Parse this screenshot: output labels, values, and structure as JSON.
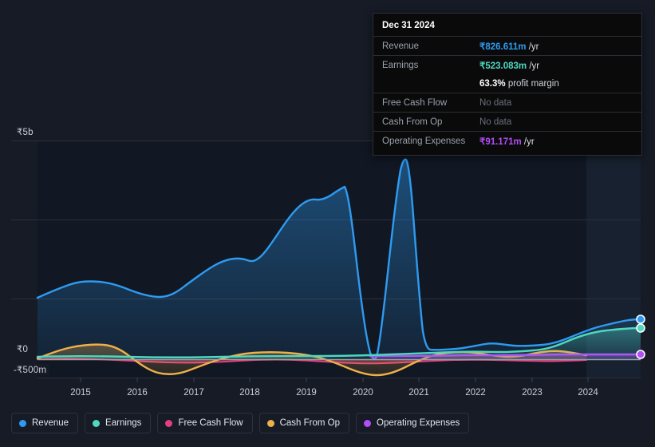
{
  "tooltip": {
    "title": "Dec 31 2024",
    "rows": [
      {
        "label": "Revenue",
        "amount": "₹826.611m",
        "unit": "/yr",
        "kind": "rev"
      },
      {
        "label": "Earnings",
        "amount": "₹523.083m",
        "unit": "/yr",
        "kind": "earn"
      },
      {
        "label": "",
        "amount": "63.3%",
        "unit": "profit margin",
        "kind": "margin"
      },
      {
        "label": "Free Cash Flow",
        "amount": "No data",
        "unit": "",
        "kind": "nodata"
      },
      {
        "label": "Cash From Op",
        "amount": "No data",
        "unit": "",
        "kind": "nodata"
      },
      {
        "label": "Operating Expenses",
        "amount": "₹91.171m",
        "unit": "/yr",
        "kind": "opex"
      }
    ]
  },
  "axis": {
    "y_labels": [
      "₹5b",
      "₹0",
      "-₹500m"
    ],
    "y_top": "₹5b",
    "y_zero": "₹0",
    "y_bottom": "-₹500m",
    "x_labels": [
      "2015",
      "2016",
      "2017",
      "2018",
      "2019",
      "2020",
      "2021",
      "2022",
      "2023",
      "2024"
    ]
  },
  "legend": {
    "items": [
      {
        "label": "Revenue",
        "color": "#2e9bf0"
      },
      {
        "label": "Earnings",
        "color": "#4fd8c0"
      },
      {
        "label": "Free Cash Flow",
        "color": "#e0407f"
      },
      {
        "label": "Cash From Op",
        "color": "#eeb04a"
      },
      {
        "label": "Operating Expenses",
        "color": "#b14ef5"
      }
    ]
  },
  "colors": {
    "background": "#161b26",
    "plot_background": "#111723",
    "forecast_background": "#18212f",
    "gridline": "#2a303c",
    "zero_line": "#9aa0ac",
    "revenue": "#2e9bf0",
    "earnings": "#4fd8c0",
    "free_cash_flow": "#e0407f",
    "cash_from_op": "#eeb04a",
    "operating_expenses": "#b14ef5"
  },
  "chart_data": {
    "type": "area",
    "title": "",
    "xlabel": "",
    "ylabel": "",
    "ylim": [
      -500000000,
      5000000000
    ],
    "y_ticks": [
      5000000000,
      3333000000,
      1667000000,
      0,
      -500000000
    ],
    "y_tick_labels": [
      "₹5b",
      "",
      "",
      "₹0",
      "-₹500m"
    ],
    "x": [
      "2015",
      "2016",
      "2017",
      "2018",
      "2019",
      "2020",
      "2021",
      "2022",
      "2023",
      "2024"
    ],
    "grid": true,
    "legend_position": "bottom",
    "forecast_start": "2024.0",
    "currency": "INR",
    "series": [
      {
        "name": "Revenue",
        "color": "#2e9bf0",
        "points": [
          {
            "x": 2014.45,
            "y": 1360
          },
          {
            "x": 2015.0,
            "y": 1480
          },
          {
            "x": 2015.4,
            "y": 1560
          },
          {
            "x": 2015.85,
            "y": 1540
          },
          {
            "x": 2016.3,
            "y": 1420
          },
          {
            "x": 2016.75,
            "y": 1385
          },
          {
            "x": 2017.1,
            "y": 1490
          },
          {
            "x": 2017.6,
            "y": 1660
          },
          {
            "x": 2018.1,
            "y": 1790
          },
          {
            "x": 2018.6,
            "y": 1880
          },
          {
            "x": 2018.9,
            "y": 1930
          },
          {
            "x": 2019.2,
            "y": 2300
          },
          {
            "x": 2019.55,
            "y": 2950
          },
          {
            "x": 2019.85,
            "y": 3720
          },
          {
            "x": 2020.0,
            "y": 3100
          },
          {
            "x": 2020.15,
            "y": 1500
          },
          {
            "x": 2020.35,
            "y": 330
          },
          {
            "x": 2020.45,
            "y": 120
          },
          {
            "x": 2020.6,
            "y": 1400
          },
          {
            "x": 2020.85,
            "y": 3600
          },
          {
            "x": 2021.0,
            "y": 4350
          },
          {
            "x": 2021.15,
            "y": 4200
          },
          {
            "x": 2021.3,
            "y": 3000
          },
          {
            "x": 2021.45,
            "y": 900
          },
          {
            "x": 2021.55,
            "y": 400
          },
          {
            "x": 2021.8,
            "y": 390
          },
          {
            "x": 2022.1,
            "y": 430
          },
          {
            "x": 2022.35,
            "y": 470
          },
          {
            "x": 2022.6,
            "y": 420
          },
          {
            "x": 2022.9,
            "y": 440
          },
          {
            "x": 2023.2,
            "y": 450
          },
          {
            "x": 2023.5,
            "y": 420
          },
          {
            "x": 2023.75,
            "y": 520
          },
          {
            "x": 2024.0,
            "y": 600
          },
          {
            "x": 2024.3,
            "y": 700
          },
          {
            "x": 2024.6,
            "y": 790
          },
          {
            "x": 2024.9,
            "y": 826.611
          }
        ],
        "end_value": 826.611,
        "end_label": "₹826.611m"
      },
      {
        "name": "Earnings",
        "color": "#4fd8c0",
        "points": [
          {
            "x": 2014.45,
            "y": 40
          },
          {
            "x": 2015.5,
            "y": 45
          },
          {
            "x": 2016.5,
            "y": 40
          },
          {
            "x": 2017.5,
            "y": 45
          },
          {
            "x": 2018.5,
            "y": 50
          },
          {
            "x": 2019.5,
            "y": 55
          },
          {
            "x": 2020.2,
            "y": 60
          },
          {
            "x": 2020.8,
            "y": 70
          },
          {
            "x": 2021.3,
            "y": 75
          },
          {
            "x": 2021.9,
            "y": 85
          },
          {
            "x": 2022.4,
            "y": 110
          },
          {
            "x": 2022.9,
            "y": 95
          },
          {
            "x": 2023.3,
            "y": 105
          },
          {
            "x": 2023.7,
            "y": 130
          },
          {
            "x": 2024.1,
            "y": 290
          },
          {
            "x": 2024.5,
            "y": 440
          },
          {
            "x": 2024.9,
            "y": 523.083
          }
        ],
        "end_value": 523.083,
        "end_label": "₹523.083m"
      },
      {
        "name": "Free Cash Flow",
        "color": "#e0407f",
        "points": [
          {
            "x": 2014.45,
            "y": -10
          },
          {
            "x": 2015.2,
            "y": 10
          },
          {
            "x": 2015.9,
            "y": -10
          },
          {
            "x": 2016.6,
            "y": -30
          },
          {
            "x": 2017.3,
            "y": -25
          },
          {
            "x": 2018.0,
            "y": -15
          },
          {
            "x": 2018.8,
            "y": -5
          },
          {
            "x": 2019.6,
            "y": -20
          },
          {
            "x": 2020.3,
            "y": -35
          },
          {
            "x": 2021.0,
            "y": -5
          },
          {
            "x": 2021.8,
            "y": 5
          },
          {
            "x": 2022.5,
            "y": -10
          },
          {
            "x": 2023.2,
            "y": 0
          },
          {
            "x": 2023.8,
            "y": -5
          },
          {
            "x": 2024.0,
            "y": null
          }
        ],
        "end_value": null,
        "end_label": "No data"
      },
      {
        "name": "Cash From Op",
        "color": "#eeb04a",
        "points": [
          {
            "x": 2014.45,
            "y": 20
          },
          {
            "x": 2015.0,
            "y": 110
          },
          {
            "x": 2015.5,
            "y": 170
          },
          {
            "x": 2015.9,
            "y": 150
          },
          {
            "x": 2016.3,
            "y": 10
          },
          {
            "x": 2016.7,
            "y": -210
          },
          {
            "x": 2017.1,
            "y": -245
          },
          {
            "x": 2017.6,
            "y": -140
          },
          {
            "x": 2018.1,
            "y": -20
          },
          {
            "x": 2018.6,
            "y": 70
          },
          {
            "x": 2019.1,
            "y": 115
          },
          {
            "x": 2019.6,
            "y": 120
          },
          {
            "x": 2020.0,
            "y": 40
          },
          {
            "x": 2020.4,
            "y": -180
          },
          {
            "x": 2020.8,
            "y": -255
          },
          {
            "x": 2021.1,
            "y": -120
          },
          {
            "x": 2021.5,
            "y": 60
          },
          {
            "x": 2021.9,
            "y": 130
          },
          {
            "x": 2022.3,
            "y": 95
          },
          {
            "x": 2022.7,
            "y": 60
          },
          {
            "x": 2023.1,
            "y": 130
          },
          {
            "x": 2023.5,
            "y": 105
          },
          {
            "x": 2023.9,
            "y": 75
          },
          {
            "x": 2024.0,
            "y": null
          }
        ],
        "end_value": null,
        "end_label": "No data"
      },
      {
        "name": "Operating Expenses",
        "color": "#b14ef5",
        "points": [
          {
            "x": 2020.45,
            "y": 60
          },
          {
            "x": 2021.0,
            "y": 65
          },
          {
            "x": 2021.6,
            "y": 70
          },
          {
            "x": 2022.2,
            "y": 72
          },
          {
            "x": 2022.8,
            "y": 75
          },
          {
            "x": 2023.4,
            "y": 80
          },
          {
            "x": 2024.0,
            "y": 85
          },
          {
            "x": 2024.5,
            "y": 88
          },
          {
            "x": 2024.9,
            "y": 91.171
          }
        ],
        "end_value": 91.171,
        "end_label": "₹91.171m"
      }
    ]
  }
}
